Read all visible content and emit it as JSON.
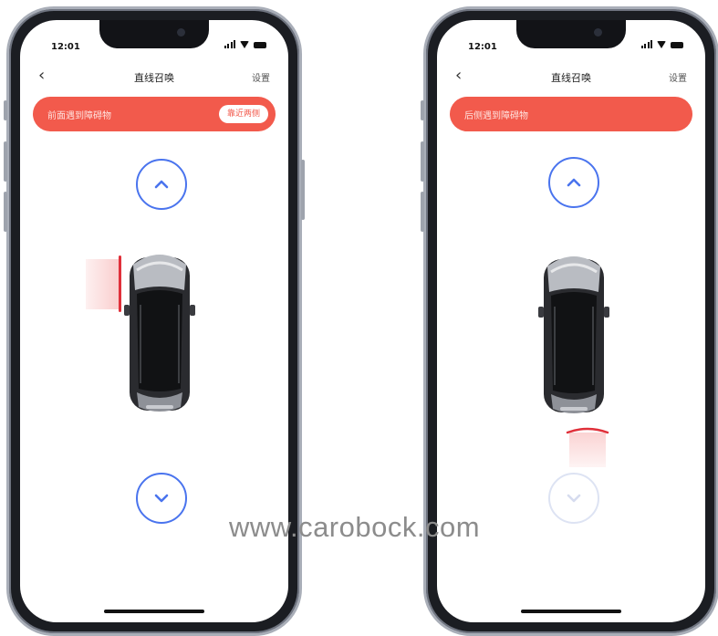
{
  "phones": [
    {
      "status": {
        "time": "12:01"
      },
      "nav": {
        "back_icon": "‹",
        "title": "直线召唤",
        "settings": "设置"
      },
      "alert": {
        "text": "前面遇到障碍物",
        "action_label": "靠近两侧",
        "color": "#f25a4c"
      },
      "controls": {
        "forward_icon": "chevron-up-icon",
        "backward_icon": "chevron-down-icon",
        "backward_enabled": true
      },
      "obstacle": {
        "side": "front-left"
      }
    },
    {
      "status": {
        "time": "12:01"
      },
      "nav": {
        "back_icon": "‹",
        "title": "直线召唤",
        "settings": "设置"
      },
      "alert": {
        "text": "后侧遇到障碍物",
        "color": "#f25a4c"
      },
      "controls": {
        "forward_icon": "chevron-up-icon",
        "backward_icon": "chevron-down-icon",
        "backward_enabled": false
      },
      "obstacle": {
        "side": "rear"
      }
    }
  ],
  "watermark": "www.carobock.com",
  "colors": {
    "accent": "#4a74ee",
    "alert": "#f25a4c",
    "obstacle": "#e0303a"
  }
}
